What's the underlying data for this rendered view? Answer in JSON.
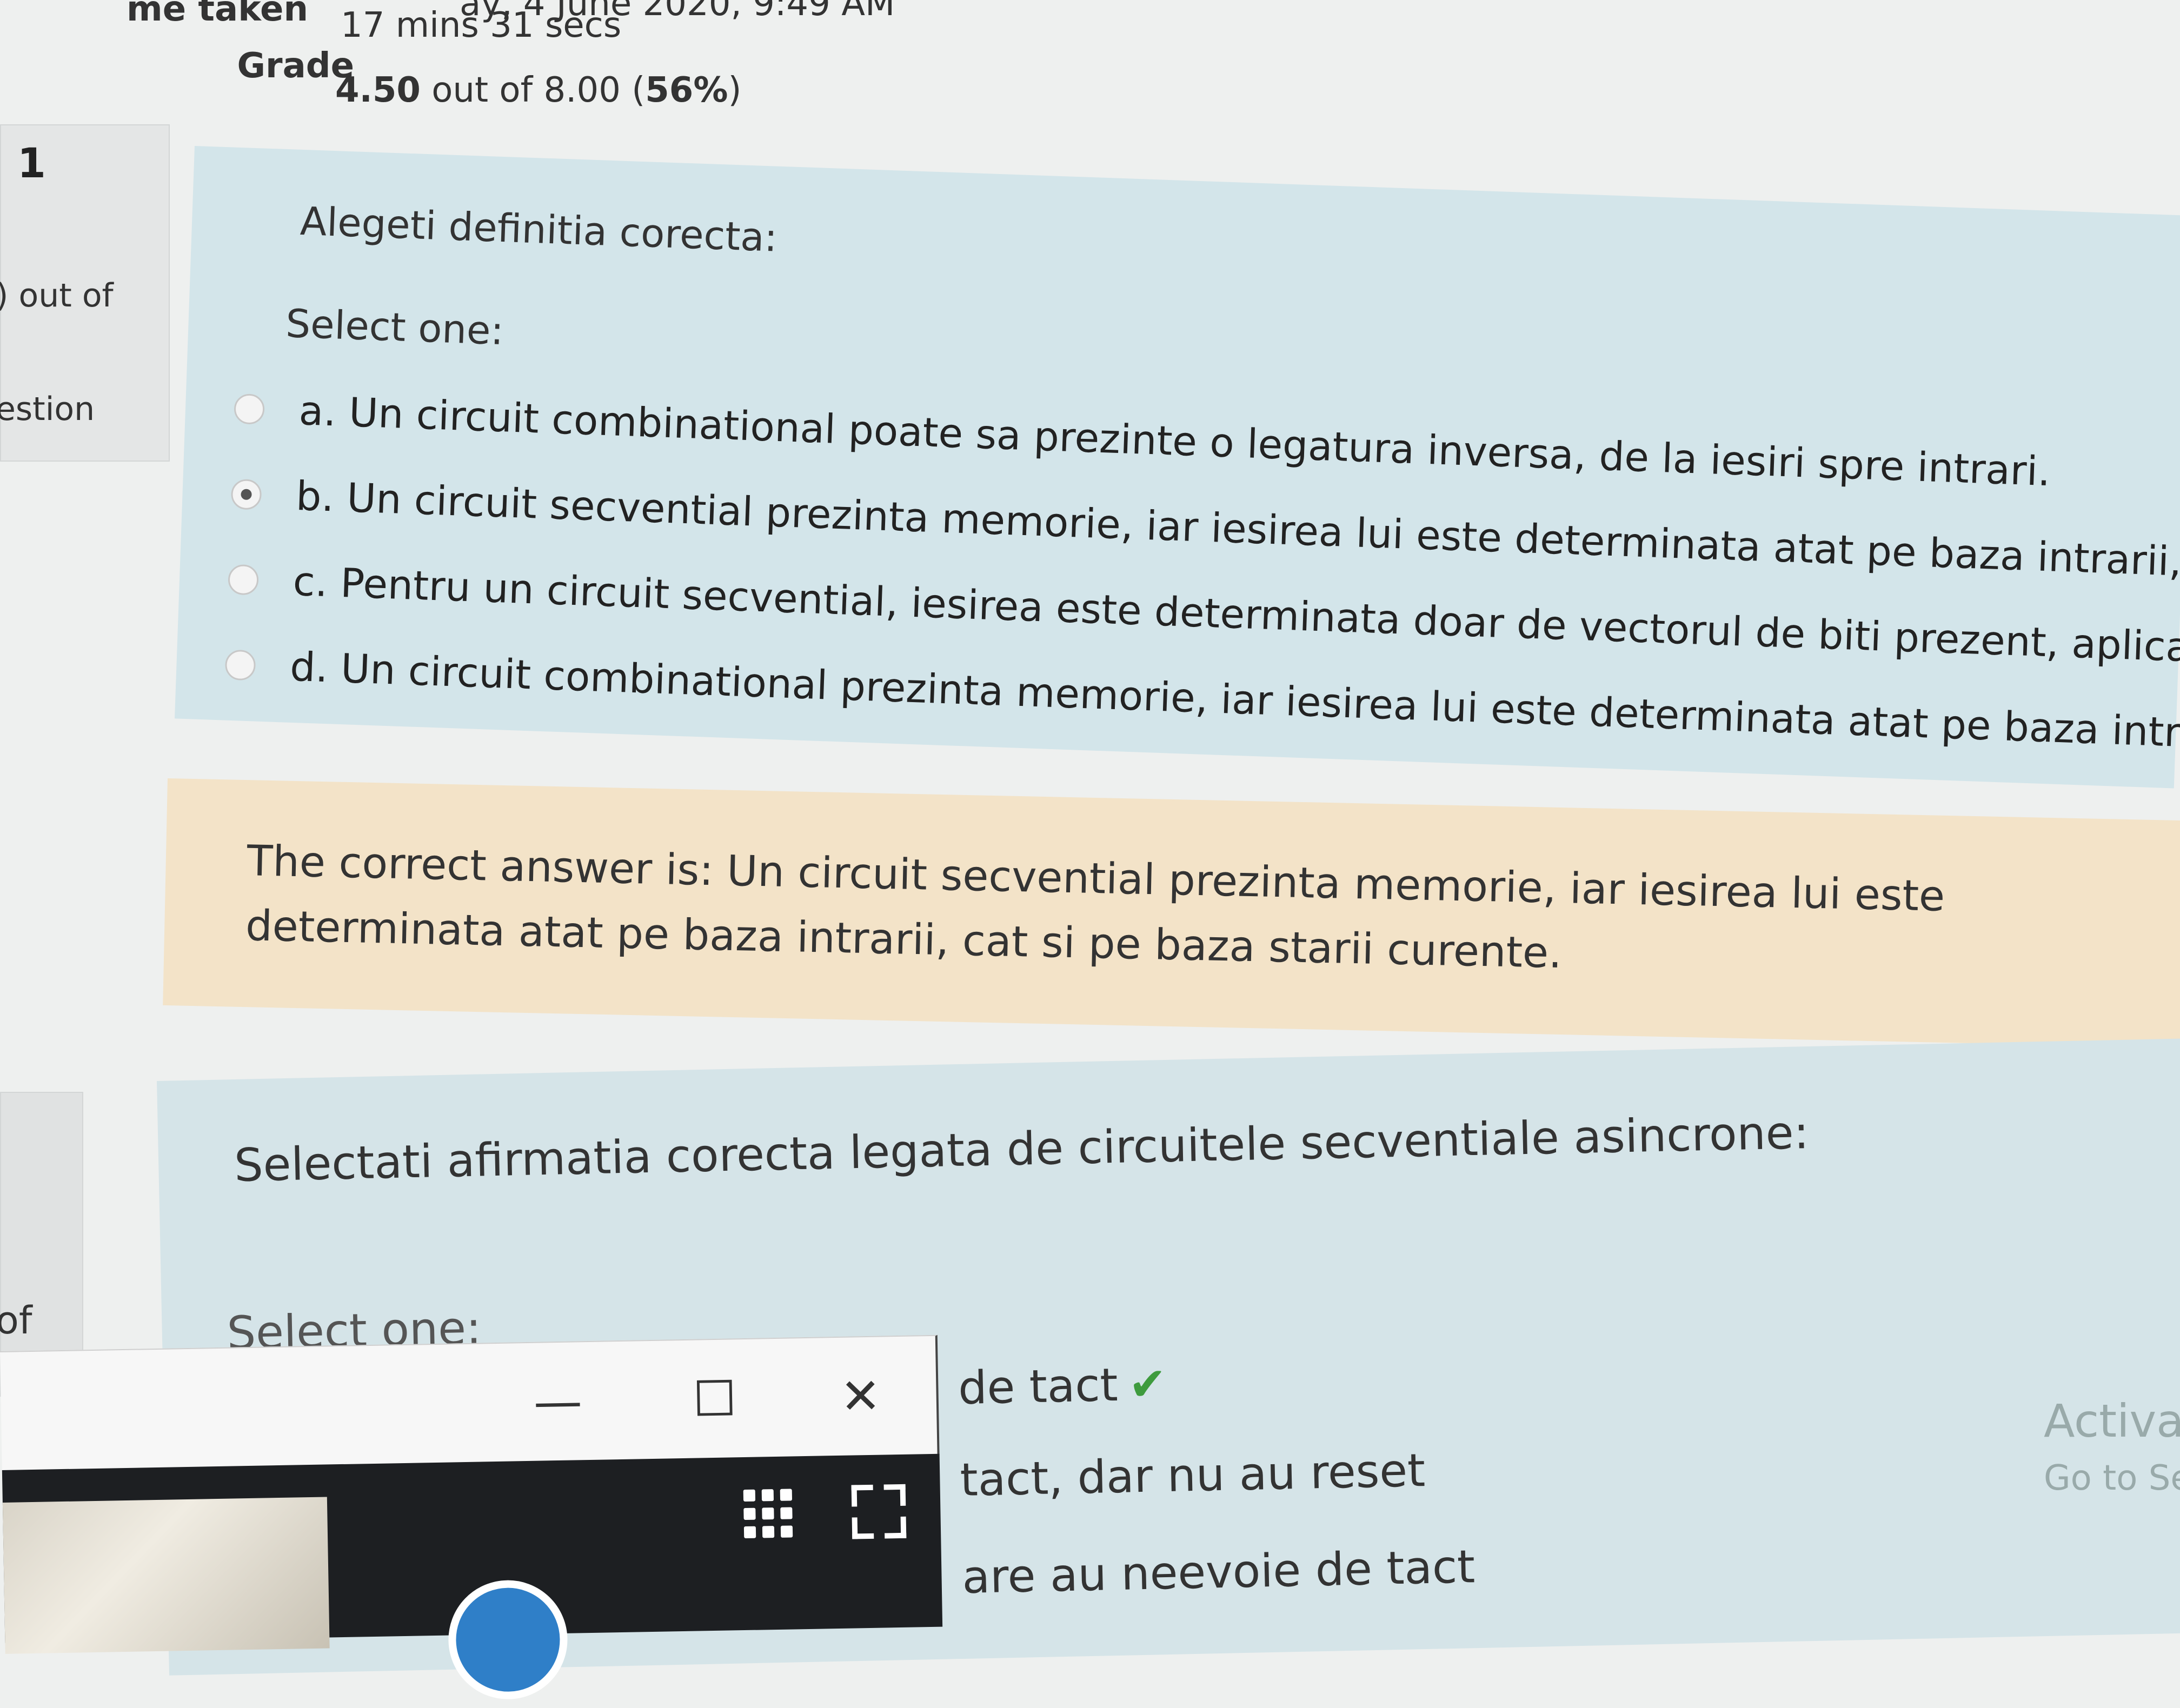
{
  "summary": {
    "started_value": "ay, 4 June 2020, 9:49 AM",
    "time_label": "me taken",
    "time_value": "17 mins 31 secs",
    "grade_label": "Grade",
    "grade_score": "4.50",
    "grade_rest": " out of 8.00 (",
    "grade_percent": "56%",
    "grade_close": ")"
  },
  "question1": {
    "number": "1",
    "mark_fragment": ") out of",
    "flag_fragment": "estion",
    "text": "Alegeti definitia corecta:",
    "prompt": "Select one:",
    "options": [
      {
        "label": "a. Un circuit combinational poate sa prezinte o legatura inversa, de la iesiri spre intrari.",
        "checked": false
      },
      {
        "label": "b. Un circuit secvential prezinta memorie, iar iesirea lui este determinata atat pe baza intrarii, cat si pe baza starii curente.",
        "checked": true
      },
      {
        "label": "c. Pentru un circuit secvential, iesirea este determinata doar de vectorul de biti prezent, aplicat la intrari.",
        "checked": false
      },
      {
        "label": "d. Un circuit combinational prezinta memorie, iar iesirea lui este determinata atat pe baza intrarii, cat si pe baza starii cu",
        "checked": false
      }
    ],
    "right_answer": "The correct answer is: Un circuit secvential prezinta memorie, iar iesirea lui este determinata atat pe baza intrarii, cat si pe baza starii curente."
  },
  "question2": {
    "info_fragment": "of",
    "text": "Selectati afirmatia corecta legata de circuitele secventiale asincrone:",
    "prompt": "Select one:",
    "option_fragments": [
      "de tact",
      "tact, dar nu au reset",
      "are au neevoie de tact"
    ],
    "check_icon": "✔"
  },
  "watermark": {
    "title": "Activate",
    "subtitle": "Go to Set"
  },
  "overlay_window": {
    "minimize_glyph": "—",
    "maximize_glyph": "☐",
    "close_glyph": "✕"
  },
  "colors": {
    "formulation_bg": "#d3e5ea",
    "feedback_bg": "#f3e3c8",
    "correct_green": "#3e9b3e"
  }
}
